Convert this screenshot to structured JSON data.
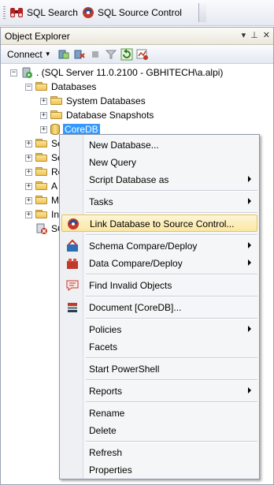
{
  "toolbar": {
    "sql_search_label": "SQL Search",
    "source_control_label": "SQL Source Control"
  },
  "panel": {
    "title": "Object Explorer",
    "connect_label": "Connect"
  },
  "tree": {
    "server_label": ". (SQL Server 11.0.2100 - GBHITECH\\a.alpi)",
    "databases_label": "Databases",
    "system_databases_label": "System Databases",
    "database_snapshots_label": "Database Snapshots",
    "selected_db_label": "CoreDB",
    "partial_items": [
      "Se",
      "Se",
      "Re",
      "A",
      "M",
      "In",
      "SC"
    ]
  },
  "context_menu": {
    "items": [
      {
        "label": "New Database..."
      },
      {
        "label": "New Query"
      },
      {
        "label": "Script Database as"
      },
      {
        "label": "Tasks"
      },
      {
        "label": "Link Database to Source Control..."
      },
      {
        "label": "Schema Compare/Deploy"
      },
      {
        "label": "Data Compare/Deploy"
      },
      {
        "label": "Find Invalid Objects"
      },
      {
        "label": "Document [CoreDB]..."
      },
      {
        "label": "Policies"
      },
      {
        "label": "Facets"
      },
      {
        "label": "Start PowerShell"
      },
      {
        "label": "Reports"
      },
      {
        "label": "Rename"
      },
      {
        "label": "Delete"
      },
      {
        "label": "Refresh"
      },
      {
        "label": "Properties"
      }
    ]
  },
  "colors": {
    "selection": "#3399ff",
    "menu_highlight": "#fbe7a3"
  }
}
